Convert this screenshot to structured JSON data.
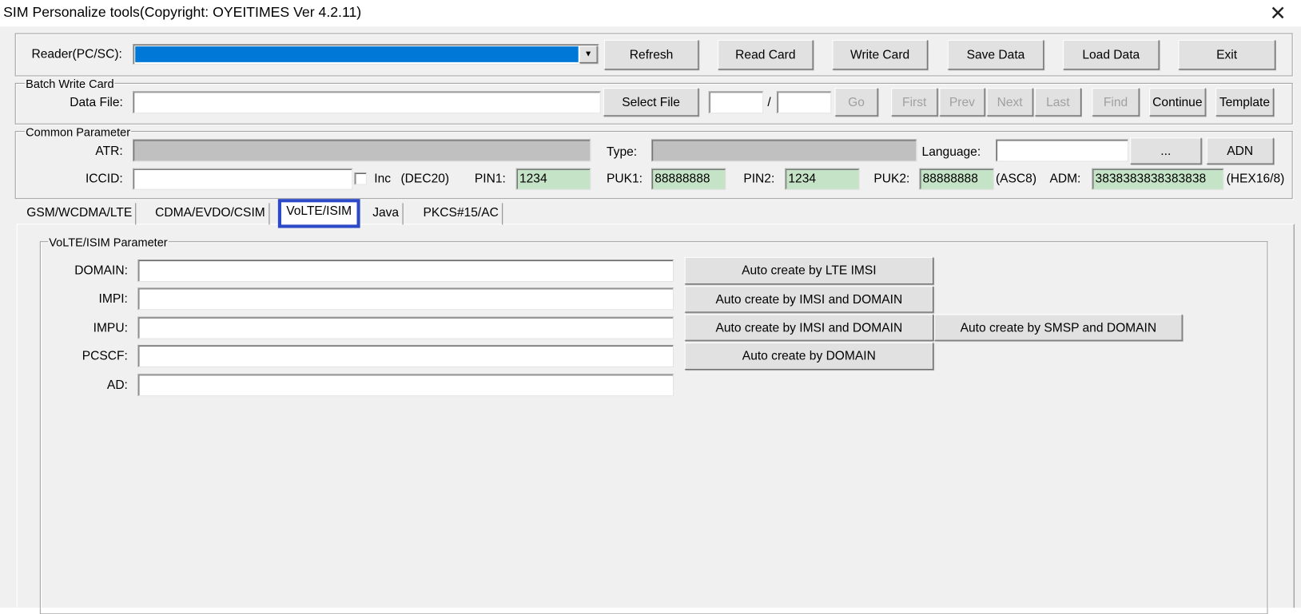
{
  "window": {
    "title": "SIM Personalize tools(Copyright: OYEITIMES Ver 4.2.11)",
    "close": "✕"
  },
  "reader": {
    "label": "Reader(PC/SC):",
    "value": "",
    "buttons": {
      "refresh": "Refresh",
      "read": "Read Card",
      "write": "Write Card",
      "save": "Save Data",
      "load": "Load Data",
      "exit": "Exit"
    }
  },
  "batch": {
    "group": "Batch Write Card",
    "data_file_label": "Data File:",
    "data_file": "",
    "select_file": "Select File",
    "index": "",
    "slash": "/",
    "total": "",
    "go": "Go",
    "first": "First",
    "prev": "Prev",
    "next": "Next",
    "last": "Last",
    "find": "Find",
    "continue": "Continue",
    "template": "Template"
  },
  "common": {
    "group": "Common Parameter",
    "atr_label": "ATR:",
    "atr": "",
    "type_label": "Type:",
    "type": "",
    "language_label": "Language:",
    "language": "",
    "browse": "...",
    "adn": "ADN",
    "iccid_label": "ICCID:",
    "iccid": "",
    "inc_label": "Inc",
    "dec20": "(DEC20)",
    "pin1_label": "PIN1:",
    "pin1": "1234",
    "puk1_label": "PUK1:",
    "puk1": "88888888",
    "pin2_label": "PIN2:",
    "pin2": "1234",
    "puk2_label": "PUK2:",
    "puk2": "88888888",
    "asc8": "(ASC8)",
    "adm_label": "ADM:",
    "adm": "3838383838383838",
    "hex": "(HEX16/8)"
  },
  "tabs": [
    "GSM/WCDMA/LTE",
    "CDMA/EVDO/CSIM",
    "VoLTE/ISIM",
    "Java",
    "PKCS#15/AC"
  ],
  "volte": {
    "group": "VoLTE/ISIM  Parameter",
    "fields": [
      {
        "label": "DOMAIN:",
        "value": ""
      },
      {
        "label": "IMPI:",
        "value": ""
      },
      {
        "label": "IMPU:",
        "value": ""
      },
      {
        "label": "PCSCF:",
        "value": ""
      },
      {
        "label": "AD:",
        "value": ""
      }
    ],
    "buttons": {
      "lte_imsi": "Auto create by LTE IMSI",
      "impi_imsi_domain": "Auto create by IMSI and DOMAIN",
      "impu_imsi_domain": "Auto create by IMSI and DOMAIN",
      "smsp_domain": "Auto create by SMSP and DOMAIN",
      "pcscf_domain": "Auto create by DOMAIN"
    }
  },
  "colors": {
    "selection": "#0078d7",
    "highlight": "#2c4ac8",
    "readonly_green": "#c5e3c6"
  }
}
